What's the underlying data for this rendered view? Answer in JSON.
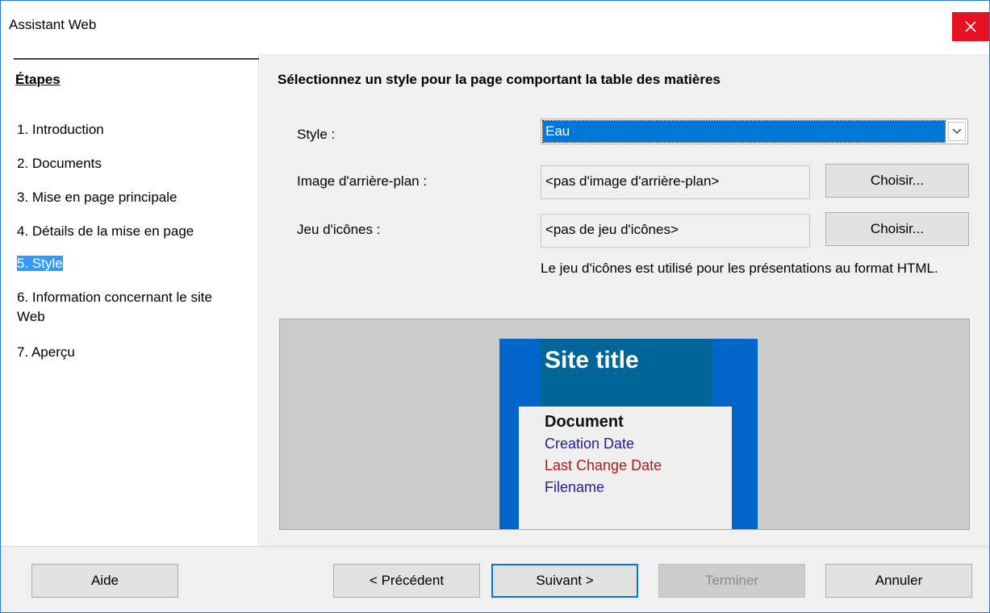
{
  "window": {
    "title": "Assistant Web"
  },
  "sidebar": {
    "heading": "Étapes",
    "items": [
      {
        "label": "1. Introduction"
      },
      {
        "label": "2. Documents"
      },
      {
        "label": "3. Mise en page principale"
      },
      {
        "label": "4. Détails de la mise en page"
      },
      {
        "label": "5. Style",
        "active": true
      },
      {
        "label": "6. Information concernant le site Web"
      },
      {
        "label": "7. Aperçu"
      }
    ]
  },
  "main": {
    "heading": "Sélectionnez un style pour la page comportant la table des matières",
    "style_label": "Style :",
    "style_value": "Eau",
    "background_label": "Image d'arrière-plan :",
    "background_value": "<pas d'image d'arrière-plan>",
    "icons_label": "Jeu d'icônes :",
    "icons_value": "<pas de jeu d'icônes>",
    "choose_label": "Choisir...",
    "note": "Le jeu d'icônes est utilisé pour les présentations au format HTML."
  },
  "preview": {
    "site_title": "Site title",
    "document": "Document",
    "creation_date": "Creation Date",
    "last_change_date": "Last Change Date",
    "filename": "Filename"
  },
  "footer": {
    "help": "Aide",
    "previous": "< Précédent",
    "next": "Suivant >",
    "finish": "Terminer",
    "cancel": "Annuler"
  },
  "colors": {
    "accent": "#0078d7",
    "close": "#e81123",
    "preview_blue": "#0066cc",
    "preview_title_bg": "#006699"
  }
}
